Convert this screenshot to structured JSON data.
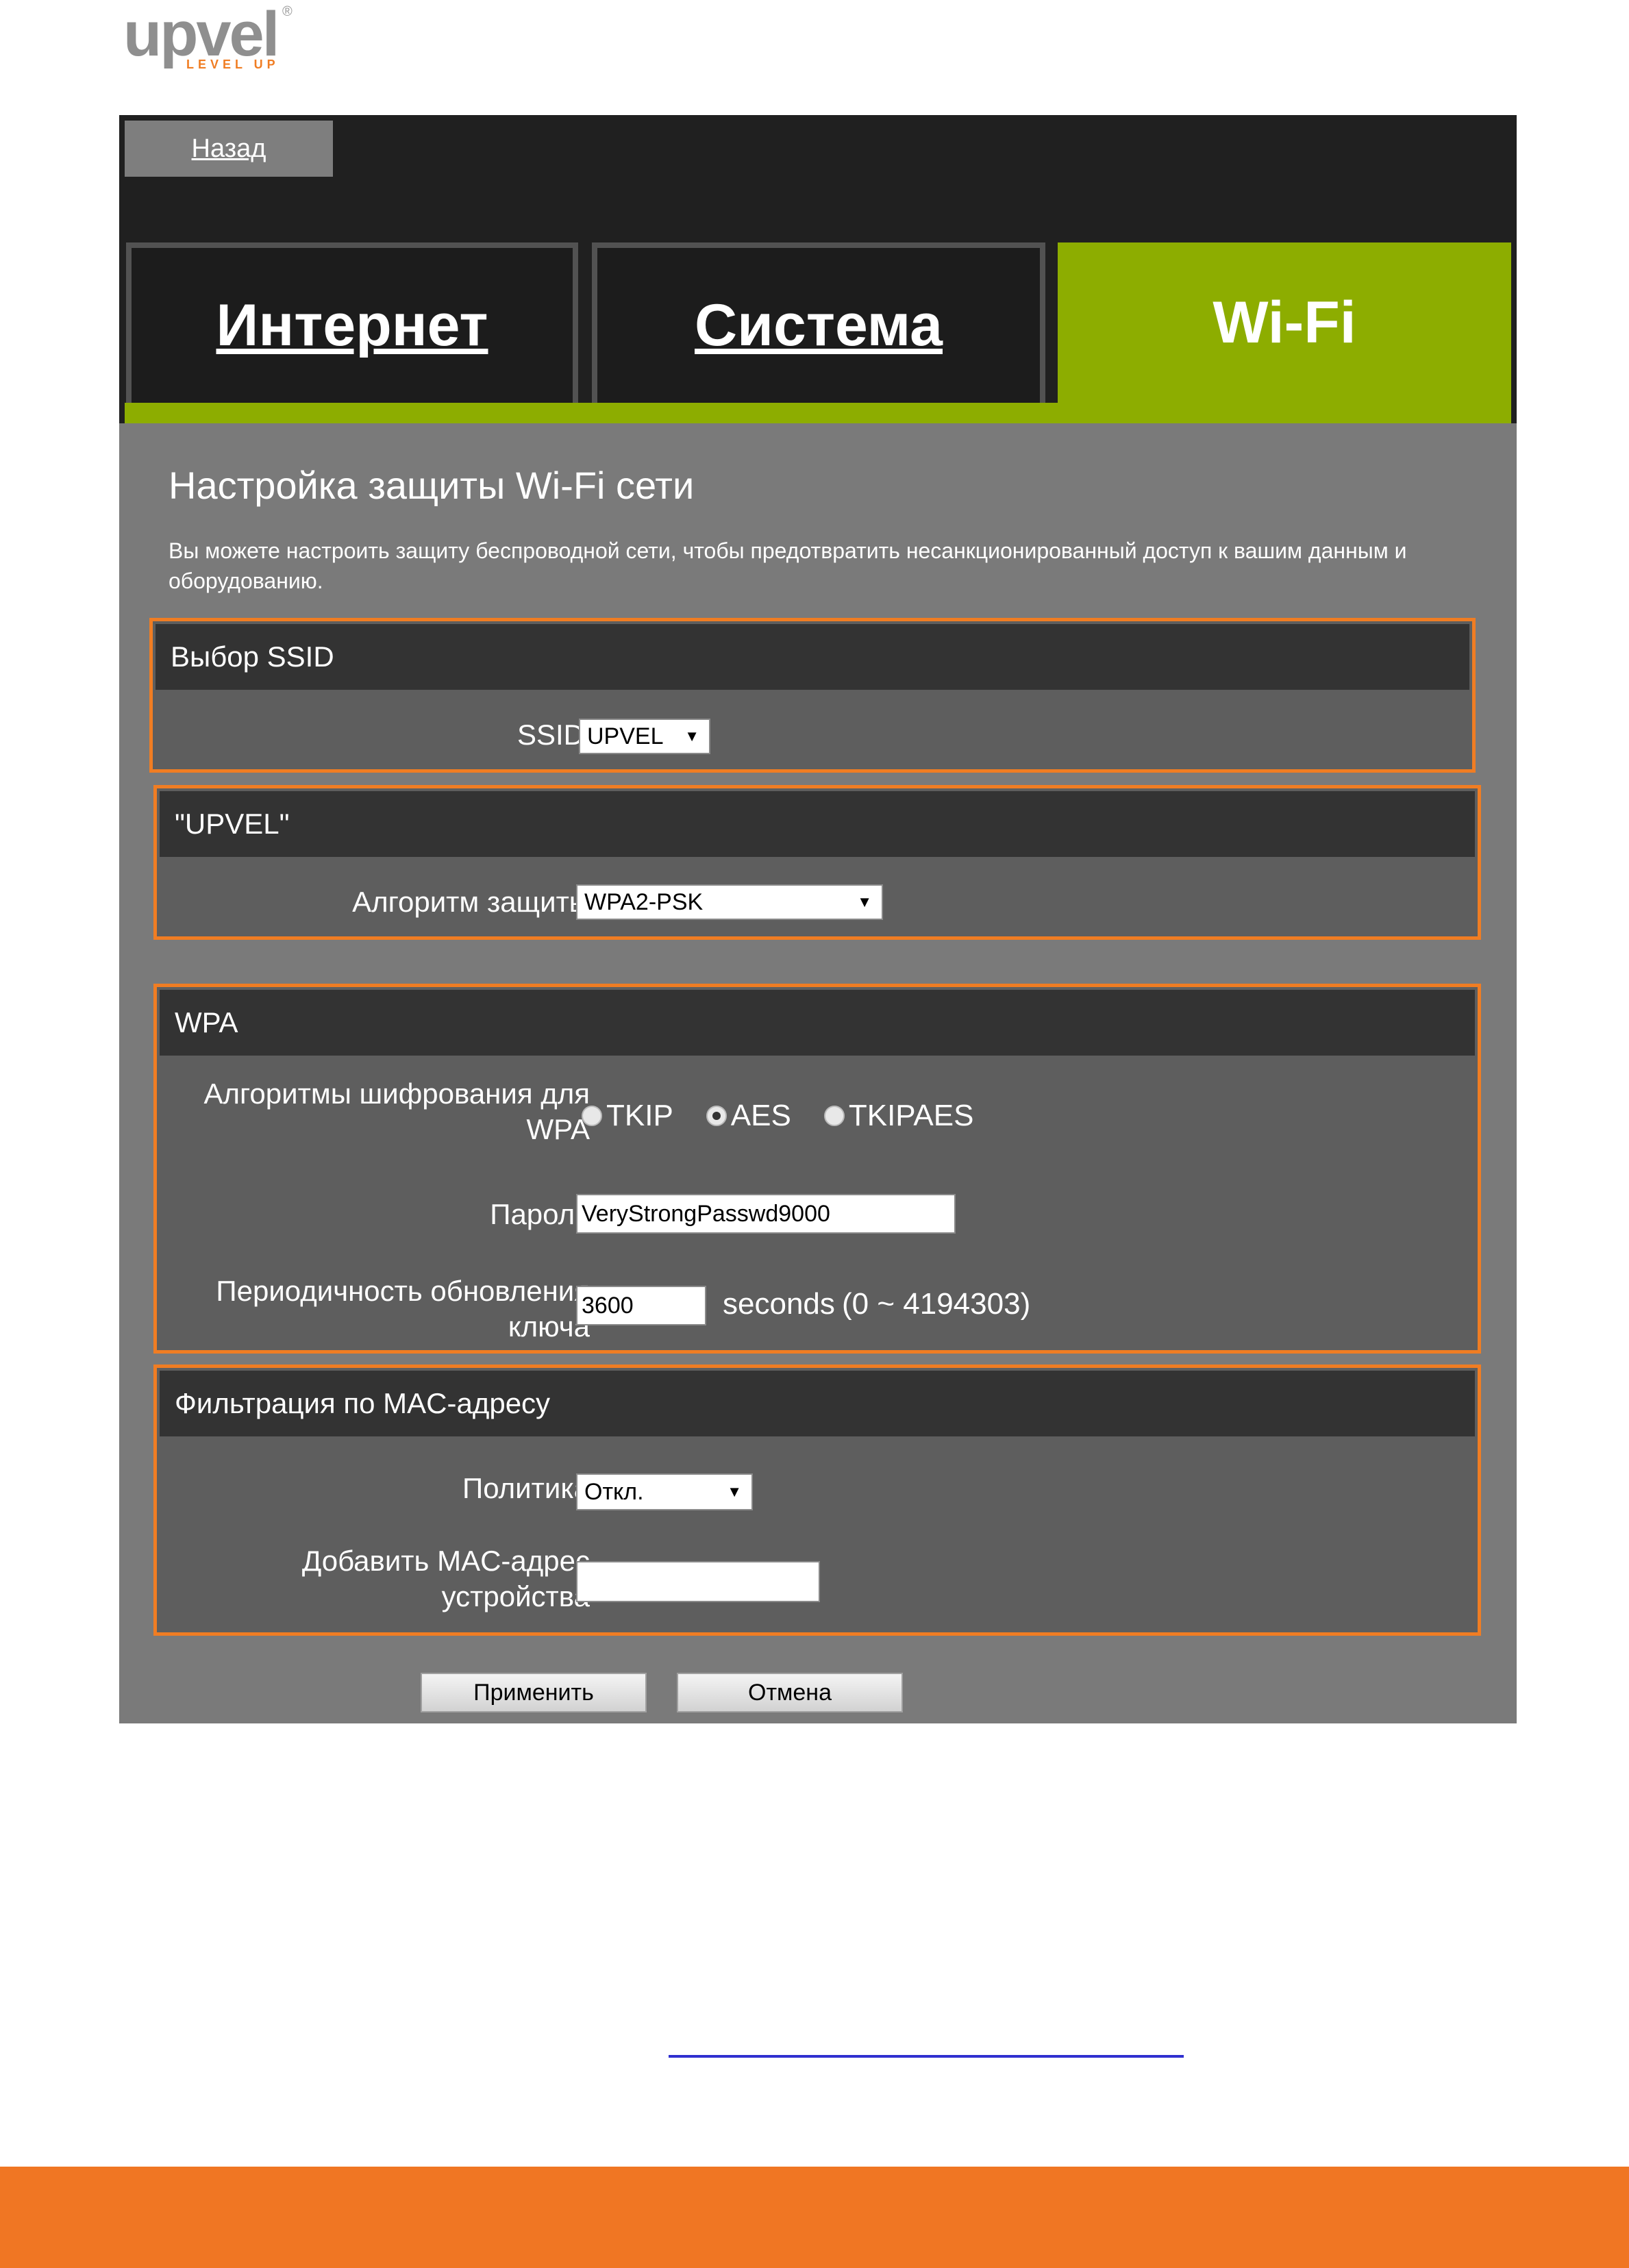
{
  "logo": {
    "word": "upvel",
    "tagline": "LEVEL UP",
    "reg": "®"
  },
  "nav": {
    "back_label": "Назад"
  },
  "tabs": [
    {
      "label": "Интернет",
      "active": false
    },
    {
      "label": "Система",
      "active": false
    },
    {
      "label": "Wi-Fi",
      "active": true
    }
  ],
  "page": {
    "title": "Настройка защиты Wi-Fi сети",
    "description": "Вы можете настроить защиту беспроводной сети, чтобы предотвратить несанкционированный доступ к вашим данным и оборудованию."
  },
  "ssid_section": {
    "title": "Выбор SSID",
    "ssid_label": "SSID",
    "ssid_value": "UPVEL"
  },
  "upvel_section": {
    "title": "\"UPVEL\"",
    "algorithm_label": "Алгоритм защиты",
    "algorithm_value": "WPA2-PSK"
  },
  "wpa_section": {
    "title": "WPA",
    "cipher_label": "Алгоритмы шифрования для WPA",
    "ciphers": [
      {
        "label": "TKIP",
        "checked": false
      },
      {
        "label": "AES",
        "checked": true
      },
      {
        "label": "TKIPAES",
        "checked": false
      }
    ],
    "password_label": "Пароль",
    "password_value": "VeryStrongPasswd9000",
    "rekey_label": "Периодичность обновления ключа",
    "rekey_value": "3600",
    "rekey_units": "seconds",
    "rekey_range": "(0 ~ 4194303)"
  },
  "mac_section": {
    "title": "Фильтрация по MAC-адресу",
    "policy_label": "Политика",
    "policy_value": "Откл.",
    "add_mac_label": "Добавить MAC-адрес устройства",
    "add_mac_value": ""
  },
  "actions": {
    "apply_label": "Применить",
    "cancel_label": "Отмена"
  },
  "colors": {
    "accent_green": "#8dad00",
    "accent_orange": "#f07d23",
    "panel_bg": "#7a7a7a"
  }
}
